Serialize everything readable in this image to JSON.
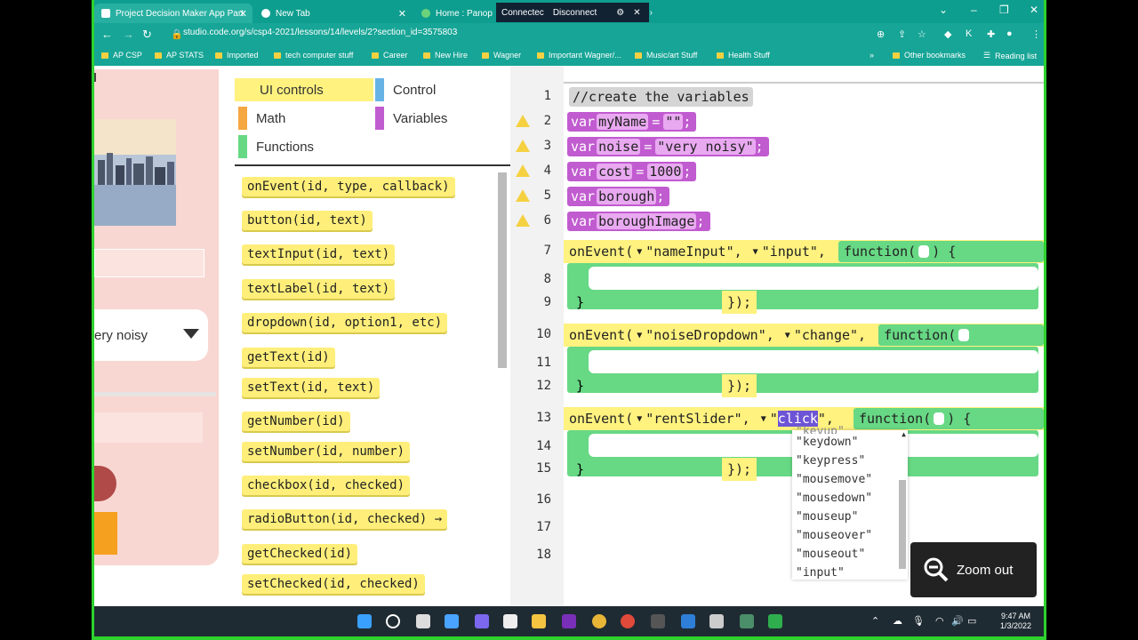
{
  "browser": {
    "tabs": [
      {
        "label": "Project Decision Maker App Part",
        "close": "✕"
      },
      {
        "label": "New Tab",
        "close": "✕"
      },
      {
        "label": "Home : Panop",
        "close": ""
      }
    ],
    "zoom_bar": {
      "connected": "Connectec",
      "disconnect": "Disconnect"
    },
    "url": "studio.code.org/s/csp4-2021/lessons/14/levels/2?section_id=3575803",
    "bookmarks": [
      "AP CSP",
      "AP STATS",
      "Imported",
      "tech computer stuff",
      "Career",
      "New Hire",
      "Wagner",
      "Important Wagner/...",
      "Music/art Stuff",
      "Health Stuff"
    ],
    "other_bookmarks": "Other bookmarks",
    "reading_list": "Reading list"
  },
  "preview": {
    "dropdown_value": "ery noisy"
  },
  "toolbox": {
    "categories": [
      "UI controls",
      "Control",
      "Math",
      "Variables",
      "Functions"
    ],
    "colors": {
      "ui": "#fff27f",
      "control": "#68b3e6",
      "math": "#f5a742",
      "variables": "#c15bd0",
      "functions": "#67d884"
    },
    "blocks": [
      "onEvent(id, type, callback)",
      "button(id, text)",
      "textInput(id, text)",
      "textLabel(id, text)",
      "dropdown(id, option1, etc)",
      "getText(id)",
      "setText(id, text)",
      "getNumber(id)",
      "setNumber(id, number)",
      "checkbox(id, checked)",
      "radioButton(id, checked) →",
      "getChecked(id)",
      "setChecked(id, checked)"
    ]
  },
  "editor": {
    "line_numbers": [
      "1",
      "2",
      "3",
      "4",
      "5",
      "6",
      "7",
      "8",
      "9",
      "10",
      "11",
      "12",
      "13",
      "14",
      "15",
      "16",
      "17",
      "18"
    ],
    "comment": "//create the variables",
    "vars": [
      {
        "kw": "var",
        "name": "myName",
        "eq": "=",
        "val": "\"\"",
        "end": ";"
      },
      {
        "kw": "var",
        "name": "noise",
        "eq": "=",
        "val": "\"very noisy\"",
        "end": ";"
      },
      {
        "kw": "var",
        "name": "cost",
        "eq": "=",
        "val": "1000",
        "end": ";"
      },
      {
        "kw": "var",
        "name": "borough",
        "eq": "",
        "val": "",
        "end": ";"
      },
      {
        "kw": "var",
        "name": "boroughImage",
        "eq": "",
        "val": "",
        "end": ";"
      }
    ],
    "events": [
      {
        "prefix": "onEvent(",
        "id": "\"nameInput\",",
        "type": "\"input\",",
        "fn": "function(",
        "fn_end": ") {"
      },
      {
        "prefix": "onEvent(",
        "id": "\"noiseDropdown\",",
        "type": "\"change\",",
        "fn": "function(",
        "fn_end": ""
      },
      {
        "prefix": "onEvent(",
        "id": "\"rentSlider\",",
        "type_q": "\"",
        "type_sel": "click",
        "type_end": "\",",
        "fn": "function(",
        "fn_end": ") {"
      }
    ],
    "closer": "});",
    "close_brace": "}"
  },
  "type_dropdown": {
    "partial_top": "\"keyup\"",
    "options": [
      "\"keydown\"",
      "\"keypress\"",
      "\"mousemove\"",
      "\"mousedown\"",
      "\"mouseup\"",
      "\"mouseover\"",
      "\"mouseout\"",
      "\"input\""
    ]
  },
  "zoom_out": {
    "label": "Zoom out"
  },
  "clock": {
    "time": "9:47 AM",
    "date": "1/3/2022"
  }
}
